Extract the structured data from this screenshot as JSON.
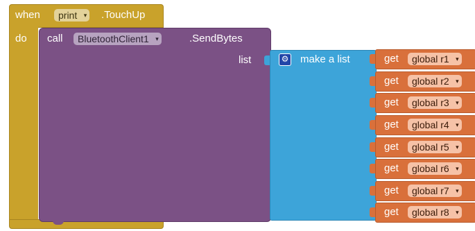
{
  "event_block": {
    "when_label": "when",
    "component": "print",
    "event": ".TouchUp",
    "do_label": "do",
    "color": "#c9a22b"
  },
  "call_block": {
    "call_label": "call",
    "component": "BluetoothClient1",
    "method": ".SendBytes",
    "param_label": "list",
    "color": "#7b5185"
  },
  "list_block": {
    "icon": "gear-icon",
    "label": "make a list",
    "color": "#3da4d9"
  },
  "get_blocks": {
    "color": "#d9703b",
    "items": [
      {
        "label": "get",
        "variable": "global r1"
      },
      {
        "label": "get",
        "variable": "global r2"
      },
      {
        "label": "get",
        "variable": "global r3"
      },
      {
        "label": "get",
        "variable": "global r4"
      },
      {
        "label": "get",
        "variable": "global r5"
      },
      {
        "label": "get",
        "variable": "global r6"
      },
      {
        "label": "get",
        "variable": "global r7"
      },
      {
        "label": "get",
        "variable": "global r8"
      }
    ]
  },
  "dropdown_arrow": "▾"
}
